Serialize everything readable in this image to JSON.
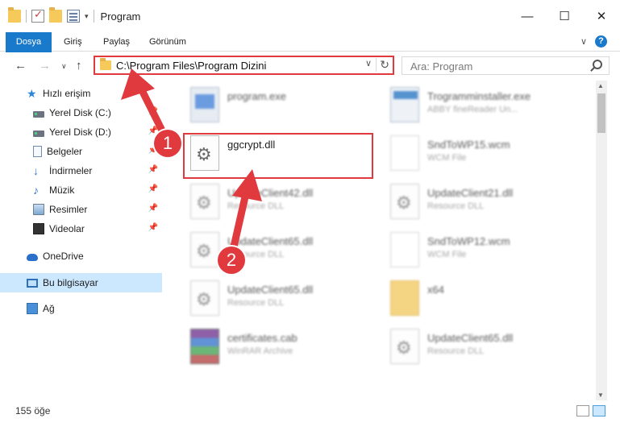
{
  "window": {
    "title": "Program",
    "controls": {
      "minimize": "—",
      "maximize": "☐",
      "close": "✕"
    }
  },
  "ribbon": {
    "tabs": [
      "Dosya",
      "Giriş",
      "Paylaş",
      "Görünüm"
    ],
    "help": "?"
  },
  "nav": {
    "address": "C:\\Program Files\\Program Dizini",
    "search_placeholder": "Ara: Program"
  },
  "sidebar": {
    "items": [
      {
        "label": "Hızlı erişim",
        "icon": "quick-access-star-icon"
      },
      {
        "label": "Yerel Disk (C:)",
        "icon": "disk-icon",
        "pinned": true
      },
      {
        "label": "Yerel Disk (D:)",
        "icon": "disk-icon",
        "pinned": true
      },
      {
        "label": "Belgeler",
        "icon": "documents-icon",
        "pinned": true
      },
      {
        "label": "İndirmeler",
        "icon": "downloads-icon",
        "pinned": true
      },
      {
        "label": "Müzik",
        "icon": "music-icon",
        "pinned": true
      },
      {
        "label": "Resimler",
        "icon": "pictures-icon",
        "pinned": true
      },
      {
        "label": "Videolar",
        "icon": "videos-icon",
        "pinned": true
      },
      {
        "label": "OneDrive",
        "icon": "onedrive-icon"
      },
      {
        "label": "Bu bilgisayar",
        "icon": "this-pc-icon",
        "selected": true
      },
      {
        "label": "Ağ",
        "icon": "network-icon"
      }
    ]
  },
  "files": [
    {
      "name": "program.exe",
      "type": "",
      "icon": "exe-icon"
    },
    {
      "name": "Trogramminstaller.exe",
      "type": "ABBY fineReader Un...",
      "icon": "installer-icon"
    },
    {
      "name": "ggcrypt.dll",
      "type": "",
      "icon": "dll-icon",
      "highlighted": true
    },
    {
      "name": "SndToWP15.wcm",
      "type": "WCM File",
      "icon": "generic-file-icon"
    },
    {
      "name": "UpdateClient42.dll",
      "type": "Resource DLL",
      "icon": "dll-icon"
    },
    {
      "name": "UpdateClient21.dll",
      "type": "Resource DLL",
      "icon": "dll-icon"
    },
    {
      "name": "UpdateClient65.dll",
      "type": "Resource DLL",
      "icon": "dll-icon"
    },
    {
      "name": "SndToWP12.wcm",
      "type": "WCM File",
      "icon": "generic-file-icon"
    },
    {
      "name": "UpdateClient65.dll",
      "type": "Resource DLL",
      "icon": "dll-icon"
    },
    {
      "name": "x64",
      "type": "",
      "icon": "folder-icon"
    },
    {
      "name": "certificates.cab",
      "type": "WinRAR Archive",
      "icon": "archive-icon"
    },
    {
      "name": "UpdateClient65.dll",
      "type": "Resource DLL",
      "icon": "dll-icon"
    }
  ],
  "status": {
    "item_count": "155 öğe"
  },
  "annotations": {
    "step1": "1",
    "step2": "2",
    "color": "#e0393e"
  }
}
